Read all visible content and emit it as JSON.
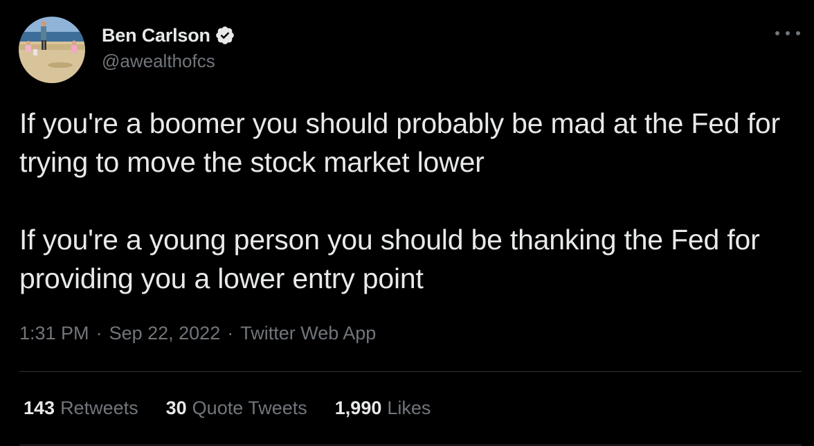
{
  "author": {
    "display_name": "Ben Carlson",
    "handle": "@awealthofcs",
    "verified": true,
    "avatar_icon": "avatar-photo-beach"
  },
  "more_icon": "more-options-icon",
  "tweet": {
    "paragraphs": [
      "If you're a boomer you should probably be mad at the Fed for trying to move the stock market lower",
      "If you're a young person you should be thanking the Fed for providing you a lower entry point"
    ]
  },
  "meta": {
    "time": "1:31 PM",
    "separator": "·",
    "date": "Sep 22, 2022",
    "source": "Twitter Web App"
  },
  "stats": [
    {
      "count": "143",
      "label": "Retweets"
    },
    {
      "count": "30",
      "label": "Quote Tweets"
    },
    {
      "count": "1,990",
      "label": "Likes"
    }
  ],
  "colors": {
    "background": "#000000",
    "text": "#e7e9ea",
    "secondary": "#71767b",
    "divider": "#2f3336",
    "verified_badge": "#e7e9ea"
  }
}
